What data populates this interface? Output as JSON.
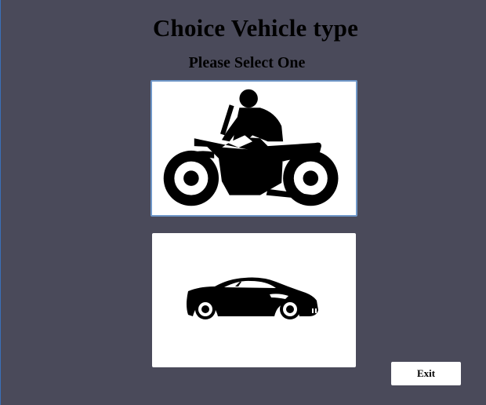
{
  "header": {
    "title": "Choice Vehicle type",
    "subtitle": "Please Select One"
  },
  "options": [
    {
      "icon": "motorcycle-icon",
      "selected": true
    },
    {
      "icon": "car-icon",
      "selected": false
    }
  ],
  "exit_button": {
    "label": "Exit"
  },
  "colors": {
    "background": "#4a4a5a",
    "card": "#ffffff",
    "selected_border": "#6f97c8",
    "text": "#000000"
  }
}
